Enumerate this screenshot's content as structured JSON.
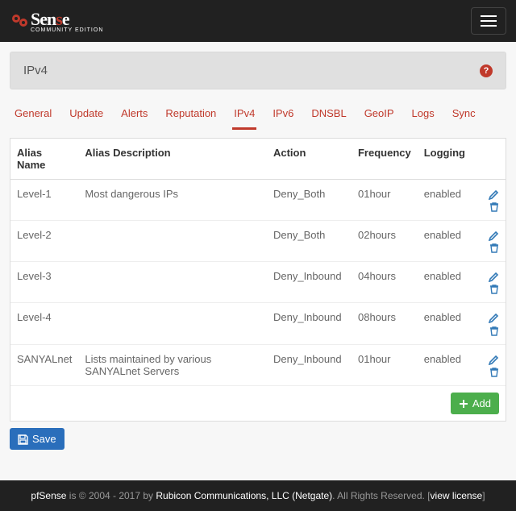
{
  "brand": {
    "name_plain": "pfSense",
    "community": "COMMUNITY EDITION"
  },
  "panel": {
    "title": "IPv4"
  },
  "tabs": [
    "General",
    "Update",
    "Alerts",
    "Reputation",
    "IPv4",
    "IPv6",
    "DNSBL",
    "GeoIP",
    "Logs",
    "Sync"
  ],
  "active_tab": "IPv4",
  "columns": {
    "name": "Alias Name",
    "desc": "Alias Description",
    "action": "Action",
    "freq": "Frequency",
    "log": "Logging"
  },
  "rows": [
    {
      "name": "Level-1",
      "desc": "Most dangerous IPs",
      "action": "Deny_Both",
      "freq": "01hour",
      "log": "enabled"
    },
    {
      "name": "Level-2",
      "desc": "",
      "action": "Deny_Both",
      "freq": "02hours",
      "log": "enabled"
    },
    {
      "name": "Level-3",
      "desc": "",
      "action": "Deny_Inbound",
      "freq": "04hours",
      "log": "enabled"
    },
    {
      "name": "Level-4",
      "desc": "",
      "action": "Deny_Inbound",
      "freq": "08hours",
      "log": "enabled"
    },
    {
      "name": "SANYALnet",
      "desc": "Lists maintained by various SANYALnet Servers",
      "action": "Deny_Inbound",
      "freq": "01hour",
      "log": "enabled"
    }
  ],
  "buttons": {
    "add": "Add",
    "save": "Save"
  },
  "footer": {
    "brand": "pfSense",
    "is_years": " is © 2004 - 2017 by ",
    "company": "Rubicon Communications, LLC (Netgate)",
    "rights": ". All Rights Reserved. [",
    "view": "view license",
    "close": "]"
  }
}
